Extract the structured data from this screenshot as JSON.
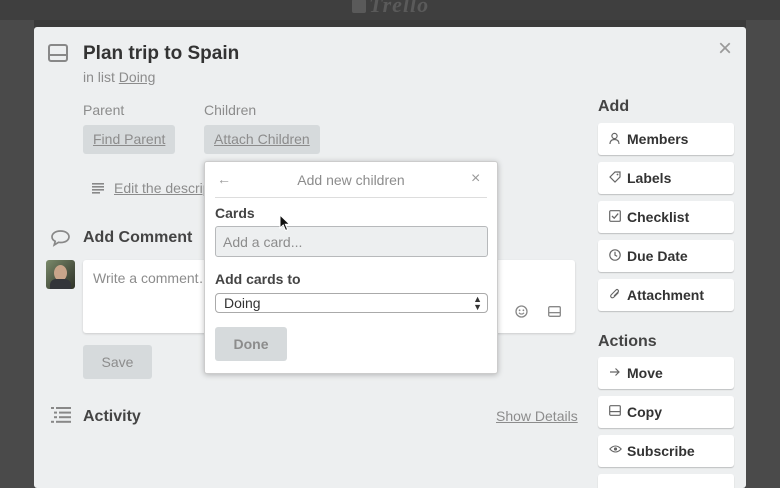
{
  "header": {
    "logo": "Trello"
  },
  "card": {
    "title": "Plan trip to Spain",
    "in_list_prefix": "in list",
    "list_name": "Doing",
    "close_glyph": "×",
    "parent_label": "Parent",
    "find_parent": "Find Parent",
    "children_label": "Children",
    "attach_children": "Attach Children",
    "edit_description": "Edit the description…",
    "add_comment_heading": "Add Comment",
    "comment_placeholder": "Write a comment…",
    "save_label": "Save",
    "activity_heading": "Activity",
    "show_details": "Show Details"
  },
  "sidebar": {
    "add_heading": "Add",
    "add_items": [
      {
        "label": "Members",
        "icon": "person-icon"
      },
      {
        "label": "Labels",
        "icon": "tag-icon"
      },
      {
        "label": "Checklist",
        "icon": "checkbox-icon"
      },
      {
        "label": "Due Date",
        "icon": "clock-icon"
      },
      {
        "label": "Attachment",
        "icon": "paperclip-icon"
      }
    ],
    "actions_heading": "Actions",
    "action_items": [
      {
        "label": "Move",
        "icon": "arrow-right-icon"
      },
      {
        "label": "Copy",
        "icon": "card-icon"
      },
      {
        "label": "Subscribe",
        "icon": "eye-icon"
      }
    ]
  },
  "popover": {
    "back_glyph": "←",
    "title": "Add new children",
    "close_glyph": "×",
    "cards_label": "Cards",
    "card_input_placeholder": "Add a card...",
    "add_to_label": "Add cards to",
    "list_selected": "Doing",
    "done_label": "Done"
  },
  "colors": {
    "overlay": "#4a4a4a",
    "panel": "#edeff0",
    "button_gray": "#d6dadc",
    "muted_text": "#8c8c8c"
  }
}
